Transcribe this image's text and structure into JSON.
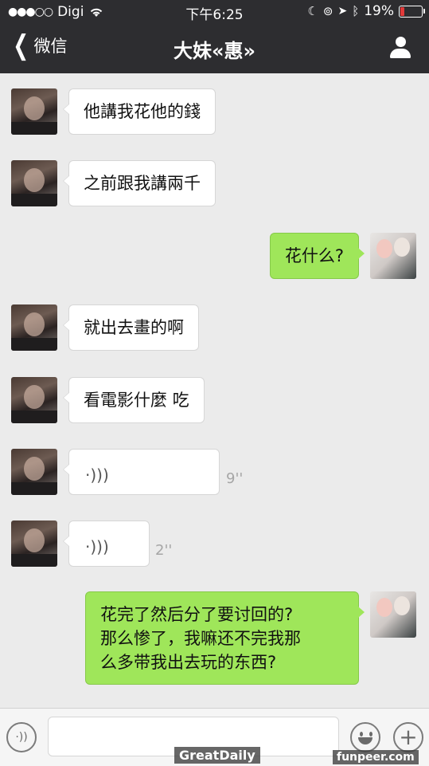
{
  "status_bar": {
    "signal_dots": "●●●○○",
    "carrier": "Digi",
    "wifi_icon": "wifi-icon",
    "time": "下午6:25",
    "battery_percent": "19%",
    "battery_level": 0.19,
    "battery_color": "#e23a3a"
  },
  "nav": {
    "back_label": "微信",
    "title": "大妹«惠»",
    "contact_icon": "person-icon"
  },
  "messages": [
    {
      "from": "contact",
      "type": "text",
      "text": "他講我花他的錢"
    },
    {
      "from": "contact",
      "type": "text",
      "text": "之前跟我講兩千"
    },
    {
      "from": "me",
      "type": "text",
      "text": "花什么?"
    },
    {
      "from": "contact",
      "type": "text",
      "text": "就出去畫的啊"
    },
    {
      "from": "contact",
      "type": "text",
      "text": "看電影什麼 吃"
    },
    {
      "from": "contact",
      "type": "voice",
      "duration": "9''"
    },
    {
      "from": "contact",
      "type": "voice",
      "duration": "2''"
    },
    {
      "from": "me",
      "type": "text",
      "lines": [
        "花完了然后分了要讨回的?",
        "那么惨了，我嘛还不完我那",
        "么多带我出去玩的东西?"
      ]
    }
  ],
  "colors": {
    "outgoing_bubble": "#9fe65a",
    "incoming_bubble": "#ffffff",
    "chat_background": "#ebebeb",
    "header": "#2d2d30"
  },
  "watermarks": {
    "left": "GreatDaily",
    "right": "funpeer.com"
  }
}
